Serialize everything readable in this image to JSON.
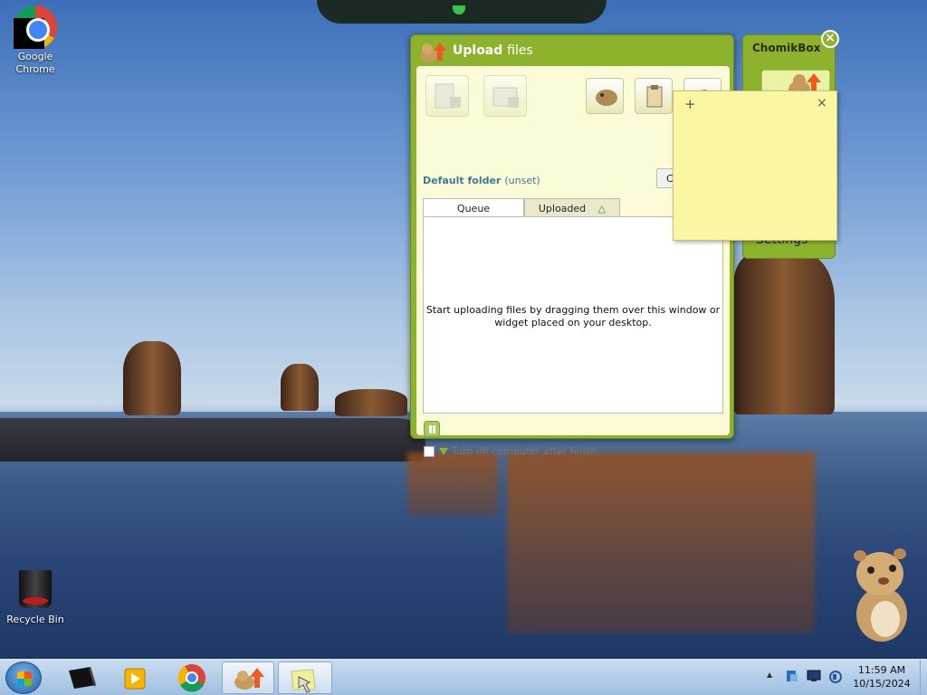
{
  "desktop": {
    "icons": [
      {
        "label_line1": "Google",
        "label_line2": "Chrome"
      },
      {
        "label": "Recycle Bin"
      }
    ]
  },
  "upload_window": {
    "title_bold": "Upload",
    "title_rest": "files",
    "default_folder_label": "Default folder",
    "default_folder_value": "(unset)",
    "change_button_label": "Change",
    "tabs": [
      {
        "label": "Queue"
      },
      {
        "label": "Uploaded"
      }
    ],
    "empty_message": "Start uploading files by dragging them over this window or widget placed on your desktop.",
    "turn_off_label": "Turn off computer after finish"
  },
  "widget": {
    "title_a": "Chomik",
    "title_b": "Box",
    "settings_label": "Settings",
    "close_glyph": "×"
  },
  "sticky_note": {
    "add_glyph": "+",
    "close_glyph": "×"
  },
  "taskbar": {
    "apps": [
      "start",
      "virtualbox",
      "media-player",
      "chrome",
      "chomikbox",
      "sticky-notes"
    ],
    "clock_time": "11:59 AM",
    "clock_date": "10/15/2024",
    "tray_arrow": "▲"
  },
  "colors": {
    "accent_green": "#8db32c",
    "panel_cream": "#fbfbd8",
    "folder_blue": "#3c7a9a"
  }
}
